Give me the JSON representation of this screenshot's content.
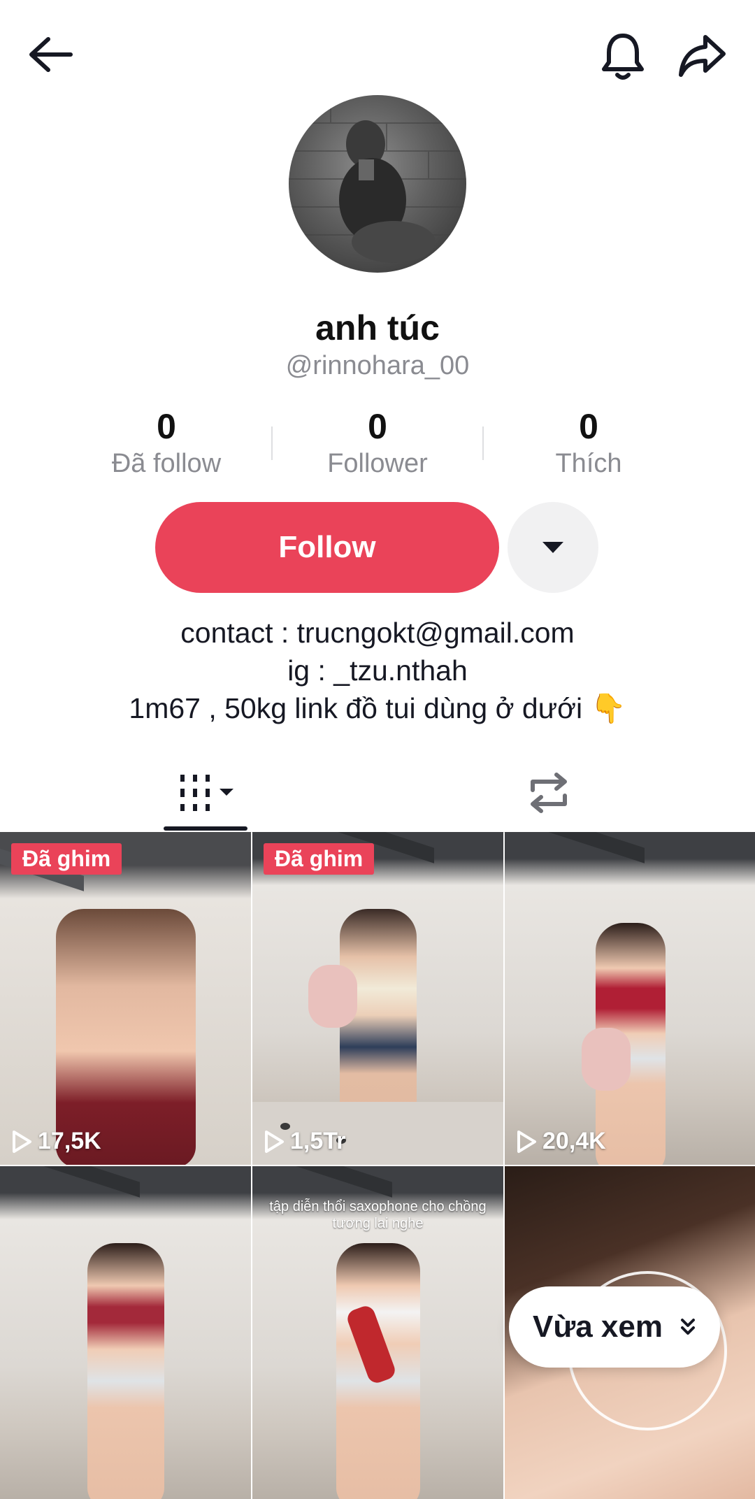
{
  "header": {
    "back_icon": "arrow-left-icon",
    "bell_icon": "bell-icon",
    "share_icon": "share-arrow-icon"
  },
  "profile": {
    "display_name": "anh túc",
    "handle": "@rinnohara_00",
    "stats": [
      {
        "value": "0",
        "label": "Đã follow"
      },
      {
        "value": "0",
        "label": "Follower"
      },
      {
        "value": "0",
        "label": "Thích"
      }
    ],
    "follow_label": "Follow",
    "bio": [
      "contact : trucngokt@gmail.com",
      "ig : _tzu.nthah",
      "1m67 , 50kg link đồ tui dùng ở dưới 👇"
    ]
  },
  "tabs": [
    {
      "icon": "videos-grid-icon",
      "active": true
    },
    {
      "icon": "repost-icon",
      "active": false
    }
  ],
  "videos": [
    {
      "pinned": "Đã ghim",
      "views": "17,5K"
    },
    {
      "pinned": "Đã ghim",
      "views": "1,5Tr"
    },
    {
      "pinned": "",
      "views": "20,4K"
    },
    {
      "pinned": "",
      "views": "",
      "caption": ""
    },
    {
      "pinned": "",
      "views": "",
      "caption": "tập diễn thổi saxophone cho chồng tương lai nghe"
    },
    {
      "pinned": "",
      "views": ""
    }
  ],
  "recently_watched": {
    "label": "Vừa xem",
    "icon": "double-chevron-down-icon"
  },
  "colors": {
    "accent": "#ea4359",
    "text": "#161823",
    "muted": "#8a8b91"
  }
}
